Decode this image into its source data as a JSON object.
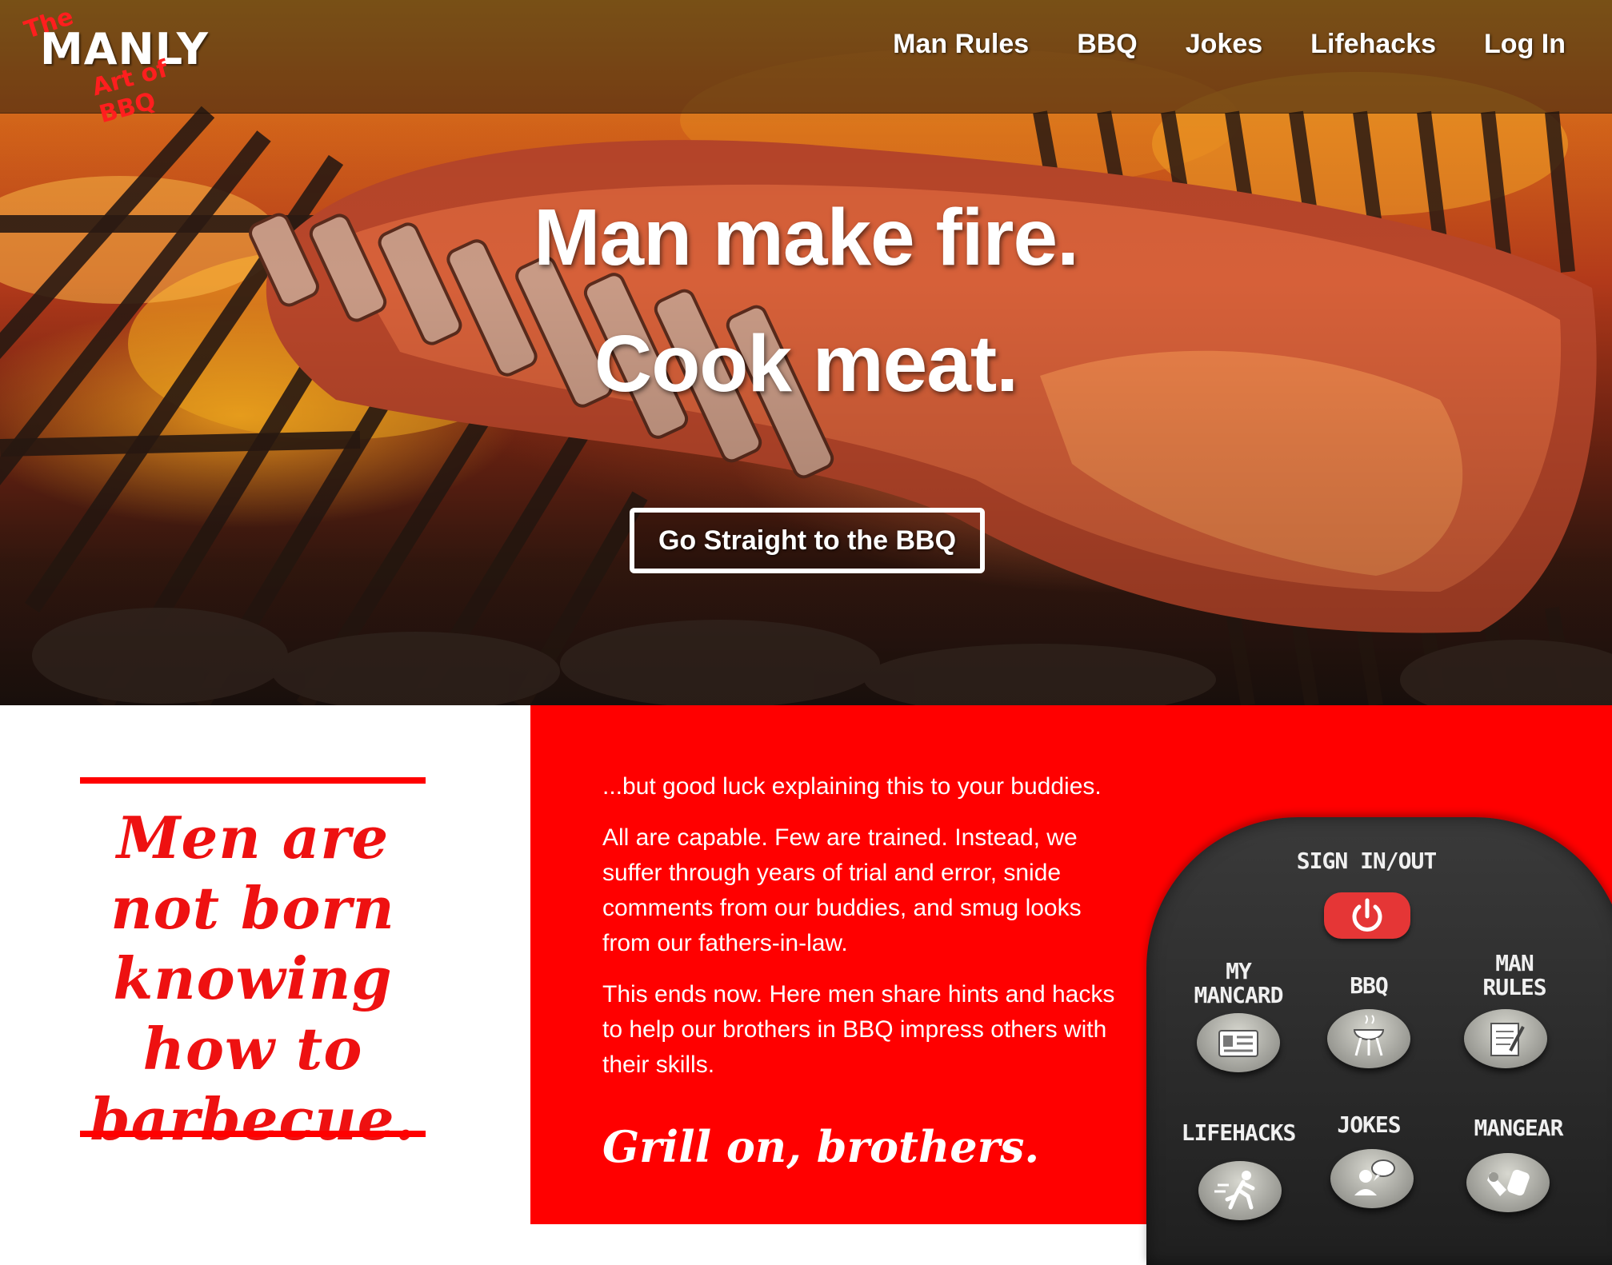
{
  "header": {
    "logo": {
      "the": "The",
      "manly": "MANLY",
      "art_of": "Art of BBQ"
    },
    "nav": [
      "Man Rules",
      "BBQ",
      "Jokes",
      "Lifehacks",
      "Log In"
    ]
  },
  "hero": {
    "headline_line1": "Man make fire.",
    "headline_line2": "Cook meat.",
    "cta_label": "Go Straight to the BBQ"
  },
  "intro": {
    "quote": "Men are not born knowing how to barbecue.",
    "paragraphs": [
      "...but good luck explaining this to your buddies.",
      "All are capable. Few are trained. Instead, we suffer through years of trial and error, snide comments from our buddies, and smug looks from our fathers-in-law.",
      "This ends now. Here men share hints and hacks to help our brothers in BBQ impress others with their skills."
    ],
    "signoff": "Grill on, brothers."
  },
  "remote": {
    "sign_in_out": "SIGN IN/OUT",
    "buttons": [
      {
        "label": "MY\nMANCARD",
        "icon": "id-card-icon"
      },
      {
        "label": "BBQ",
        "icon": "grill-icon"
      },
      {
        "label": "MAN\nRULES",
        "icon": "notepad-icon"
      },
      {
        "label": "LIFEHACKS",
        "icon": "running-man-icon"
      },
      {
        "label": "JOKES",
        "icon": "speech-bubble-icon"
      },
      {
        "label": "MANGEAR",
        "icon": "gear-tools-icon"
      }
    ]
  },
  "colors": {
    "brand_red": "#ff0000",
    "text_white": "#ffffff"
  }
}
